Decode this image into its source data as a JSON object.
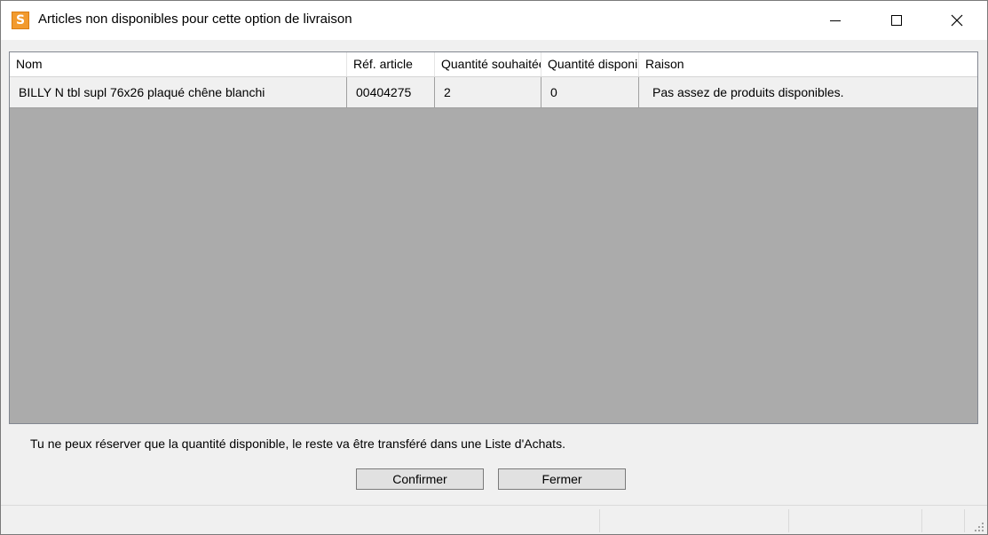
{
  "window": {
    "title": "Articles non disponibles pour cette option de livraison",
    "app_icon_letter": "S",
    "icon_color": "#f29a2e",
    "controls": {
      "minimize_icon": "minimize-icon",
      "maximize_icon": "maximize-icon",
      "close_icon": "close-icon"
    }
  },
  "grid": {
    "columns": [
      "Nom",
      "Réf. article",
      "Quantité souhaitée",
      "Quantité disponible",
      "Raison"
    ],
    "rows": [
      {
        "nom": "BILLY N tbl supl 76x26 plaqué chêne blanchi",
        "ref": "00404275",
        "qty_wanted": "2",
        "qty_available": "0",
        "reason": "Pas assez de produits disponibles."
      }
    ]
  },
  "footer": {
    "info_text": "Tu ne peux réserver que la quantité disponible, le reste va être transféré dans une Liste d'Achats.",
    "confirm_label": "Confirmer",
    "close_label": "Fermer"
  }
}
